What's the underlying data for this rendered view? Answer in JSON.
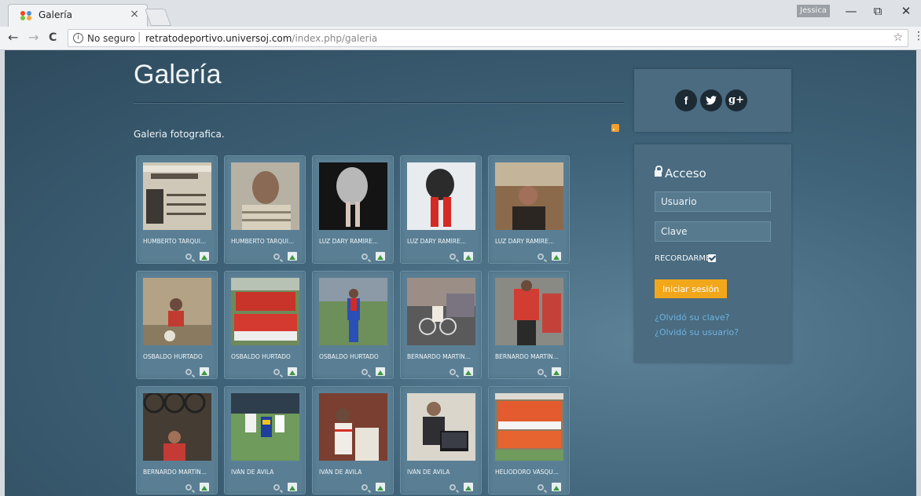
{
  "browser": {
    "tab_title": "Galería",
    "tab_close": "×",
    "profile_name": "Jessica",
    "window_controls": {
      "minimize": "—",
      "restore": "⧉",
      "close": "✕"
    },
    "nav": {
      "back": "←",
      "forward": "→",
      "reload": "C"
    },
    "security_label": "No seguro",
    "url_host": "retratodeportivo.universoj.com",
    "url_path": "/index.php/galeria",
    "bookmark_icon": "☆",
    "menu_icon": "⋮"
  },
  "page": {
    "title": "Galería",
    "subtitle": "Galeria fotografica."
  },
  "gallery": {
    "items": [
      {
        "label": "HUMBERTO TARQUI...",
        "photo": "document-id-card"
      },
      {
        "label": "HUMBERTO TARQUI...",
        "photo": "elderly-man-portrait"
      },
      {
        "label": "LUZ DARY RAMÍRE...",
        "photo": "dancer-silver-costume"
      },
      {
        "label": "LUZ DARY RAMÍRE...",
        "photo": "dancer-red-tights"
      },
      {
        "label": "LUZ DARY RAMÍRE...",
        "photo": "woman-fountain"
      },
      {
        "label": "OSBALDO HURTADO",
        "photo": "child-football"
      },
      {
        "label": "OSBALDO HURTADO",
        "photo": "football-team"
      },
      {
        "label": "OSBALDO HURTADO",
        "photo": "goalkeeper-pitch"
      },
      {
        "label": "BERNARDO MARTÍN...",
        "photo": "cyclist-race"
      },
      {
        "label": "BERNARDO MARTÍN...",
        "photo": "cyclists-red"
      },
      {
        "label": "BERNARDO MARTÍN...",
        "photo": "bike-shop"
      },
      {
        "label": "IVÁN DE ÁVILA",
        "photo": "football-match"
      },
      {
        "label": "IVÁN DE ÁVILA",
        "photo": "two-players"
      },
      {
        "label": "IVÁN DE ÁVILA",
        "photo": "man-laptop"
      },
      {
        "label": "HELIODORO VÁSQU...",
        "photo": "team-photo-red"
      }
    ]
  },
  "social": {
    "facebook": "f",
    "twitter": "t",
    "google_plus": "g+"
  },
  "login": {
    "heading": "Acceso",
    "username_placeholder": "Usuario",
    "password_placeholder": "Clave",
    "remember_label": "RECORDARME",
    "submit_label": "Iniciar sesión",
    "forgot_password": "¿Olvidó su clave?",
    "forgot_username": "¿Olvidó su usuario?"
  },
  "colors": {
    "accent_orange": "#f2a71b",
    "link_blue": "#6fb2dd",
    "panel": "#4a6b80",
    "background": "#3f6379"
  }
}
